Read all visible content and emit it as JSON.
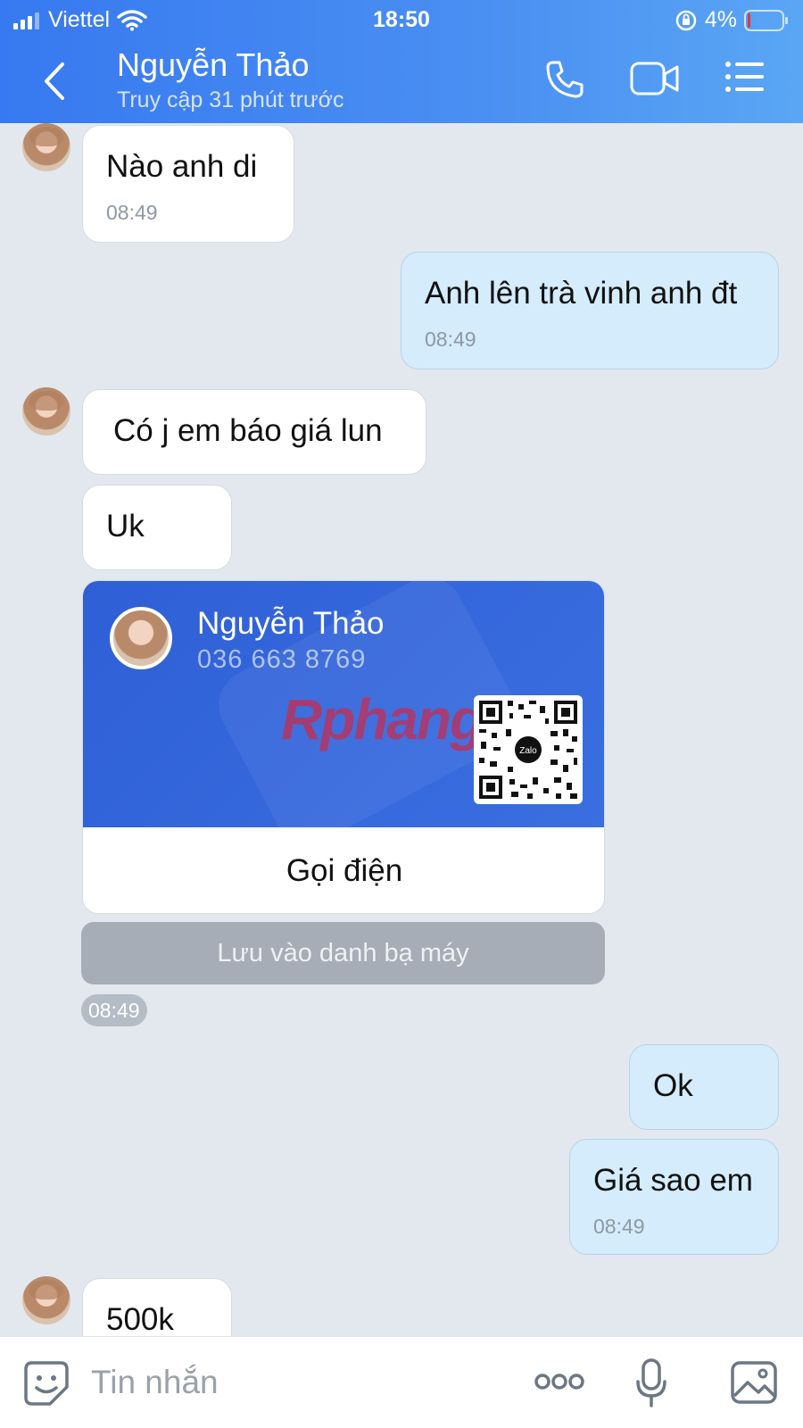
{
  "status_bar": {
    "carrier": "Viettel",
    "time": "18:50",
    "battery": "4%"
  },
  "header": {
    "contact_name": "Nguyễn Thảo",
    "contact_status": "Truy cập 31 phút trước",
    "icons": [
      "back-icon",
      "phone-icon",
      "video-icon",
      "menu-icon"
    ]
  },
  "messages": [
    {
      "direction": "in",
      "text": "Nào anh di",
      "time": "08:49"
    },
    {
      "direction": "out",
      "text": "Anh lên trà vinh anh đt",
      "time": "08:49"
    },
    {
      "direction": "in",
      "text": "Có j em báo giá lun"
    },
    {
      "direction": "in",
      "text": "Uk"
    },
    {
      "direction": "out",
      "text": "Ok"
    },
    {
      "direction": "out",
      "text": "Giá sao em",
      "time": "08:49"
    },
    {
      "direction": "in",
      "text": "500k"
    }
  ],
  "contact_card": {
    "name": "Nguyễn Thảo",
    "phone": "036 663 8769",
    "watermark": "Rphang",
    "qr_label": "Zalo",
    "call_label": "Gọi điện",
    "save_label": "Lưu vào danh bạ máy",
    "time": "08:49",
    "colors": {
      "card_bg": "#2f5fd6"
    }
  },
  "composer": {
    "placeholder": "Tin nhắn",
    "icons": [
      "sticker-icon",
      "more-icon",
      "microphone-icon",
      "image-icon"
    ]
  },
  "colors": {
    "header_start": "#3779f0",
    "header_end": "#5aa6f4",
    "chat_bg": "#e3e8ef",
    "incoming_bubble": "#ffffff",
    "outgoing_bubble": "#d4ecfb",
    "battery_low": "#e53935"
  }
}
